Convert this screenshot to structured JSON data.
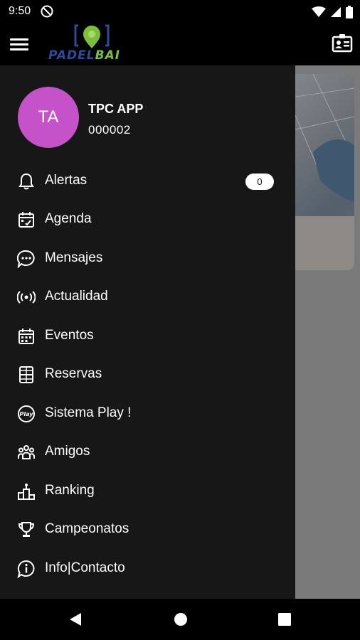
{
  "status_bar": {
    "time": "9:50",
    "icons": [
      "do-not-disturb-icon",
      "wifi-icon",
      "cellular-icon",
      "battery-icon"
    ]
  },
  "app_bar": {
    "logo_text_main": "PADEL",
    "logo_text_accent": "BAI",
    "icons": [
      "hamburger-menu-icon",
      "location-pin-icon",
      "id-card-icon"
    ]
  },
  "drawer": {
    "user": {
      "initials": "TA",
      "name": "TPC APP",
      "id": "000002"
    },
    "items": [
      {
        "label": "Alertas",
        "icon": "bell-icon",
        "badge": "0"
      },
      {
        "label": "Agenda",
        "icon": "calendar-check-icon"
      },
      {
        "label": "Mensajes",
        "icon": "chat-bubble-icon"
      },
      {
        "label": "Actualidad",
        "icon": "broadcast-icon"
      },
      {
        "label": "Eventos",
        "icon": "calendar-grid-icon"
      },
      {
        "label": "Reservas",
        "icon": "court-icon"
      },
      {
        "label": "Sistema Play !",
        "icon": "play-badge-icon",
        "icon_text": "Play"
      },
      {
        "label": "Amigos",
        "icon": "group-icon"
      },
      {
        "label": "Ranking",
        "icon": "podium-icon"
      },
      {
        "label": "Campeonatos",
        "icon": "trophy-icon"
      },
      {
        "label": "Info|Contacto",
        "icon": "info-icon"
      }
    ]
  },
  "colors": {
    "drawer_bg": "#171717",
    "avatar_bg": "#c552c9",
    "logo_blue": "#2e4a99",
    "logo_green": "#7cbf3a",
    "scrim": "#7a7a7a"
  },
  "nav_bar": {
    "icons": [
      "back-triangle-icon",
      "home-circle-icon",
      "recents-square-icon"
    ]
  }
}
